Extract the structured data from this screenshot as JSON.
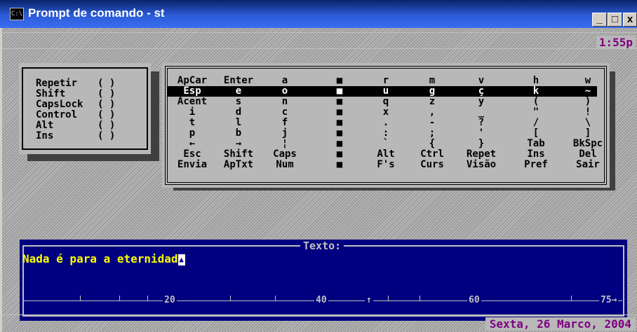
{
  "window": {
    "title": "Prompt de comando - st",
    "icon": "console-icon"
  },
  "window_buttons": {
    "minimize": "_",
    "maximize": "□",
    "close": "x"
  },
  "status": {
    "time": "1:55p",
    "date": "Sexta, 26 Marco, 2004"
  },
  "modifiers": [
    {
      "label": "Repetir",
      "state": "( )"
    },
    {
      "label": "Shift",
      "state": "( )"
    },
    {
      "label": "CapsLock",
      "state": "( )"
    },
    {
      "label": "Control",
      "state": "( )"
    },
    {
      "label": "Alt",
      "state": "( )"
    },
    {
      "label": "Ins",
      "state": "( )"
    }
  ],
  "keyboard": {
    "rows": [
      [
        "ApCar",
        "Enter",
        "a",
        "■",
        "r",
        "m",
        "v",
        "h",
        "w"
      ],
      [
        "Esp",
        "e",
        "o",
        "■",
        "u",
        "g",
        "ç",
        "k",
        "~"
      ],
      [
        "Acent",
        "s",
        "n",
        "■",
        "q",
        "z",
        "y",
        "(",
        ")"
      ],
      [
        "i",
        "d",
        "c",
        "■",
        "x",
        ",",
        "_",
        "\"",
        "!"
      ],
      [
        "t",
        "l",
        "f",
        "■",
        ".",
        "-",
        "?",
        "/",
        "\\"
      ],
      [
        "p",
        "b",
        "j",
        "■",
        ":",
        ";",
        "'",
        "[",
        "]"
      ],
      [
        "←",
        "→",
        "¦",
        "■",
        "`",
        "{",
        "}",
        "Tab",
        "BkSpc"
      ],
      [
        "Esc",
        "Shift",
        "Caps",
        "■",
        "Alt",
        "Ctrl",
        "Repet",
        "Ins",
        "Del"
      ],
      [
        "Envia",
        "ApTxt",
        "Num",
        "■",
        "F's",
        "Curs",
        "Visão",
        "Pref",
        "Sair"
      ]
    ],
    "selected_row": 1
  },
  "editor": {
    "label": "Texto:",
    "text": "Nada é para a eternidad",
    "cursor_char": "▲",
    "ruler": {
      "marks": [
        "20",
        "40",
        "60",
        "75→"
      ],
      "caret": "↑"
    }
  }
}
